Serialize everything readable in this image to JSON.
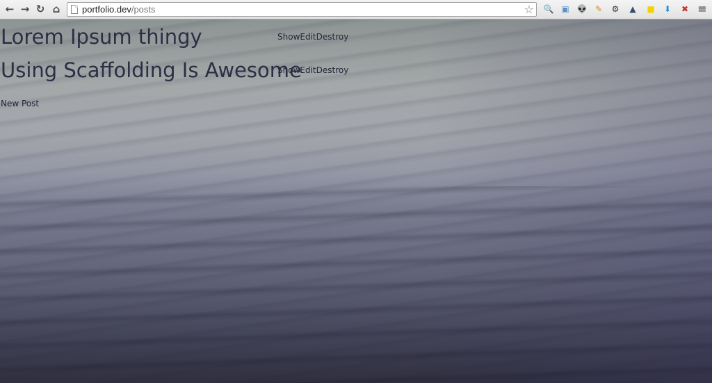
{
  "browser": {
    "url_host": "portfolio.dev",
    "url_path": "/posts",
    "nav": {
      "back": "←",
      "forward": "→",
      "reload": "↻",
      "home": "⌂"
    },
    "bookmark_star": "☆",
    "extensions": [
      {
        "name": "search-extension-icon",
        "glyph": "🔍"
      },
      {
        "name": "image-extension-icon",
        "glyph": "▣"
      },
      {
        "name": "alien-extension-icon",
        "glyph": "👽"
      },
      {
        "name": "css-extension-icon",
        "glyph": "✎"
      },
      {
        "name": "gear-icon",
        "glyph": "⚙"
      },
      {
        "name": "stamp-extension-icon",
        "glyph": "▲"
      },
      {
        "name": "yellow-box-extension-icon",
        "glyph": "■"
      },
      {
        "name": "download-extension-icon",
        "glyph": "⬇"
      },
      {
        "name": "blocker-extension-icon",
        "glyph": "✖"
      },
      {
        "name": "menu-icon",
        "glyph": "≡"
      }
    ]
  },
  "posts": [
    {
      "title": "Lorem Ipsum thingy",
      "show": "Show",
      "edit": "Edit",
      "destroy": "Destroy"
    },
    {
      "title": "Using Scaffolding Is Awesome",
      "show": "Show",
      "edit": "Edit",
      "destroy": "Destroy"
    }
  ],
  "new_post_label": "New Post"
}
